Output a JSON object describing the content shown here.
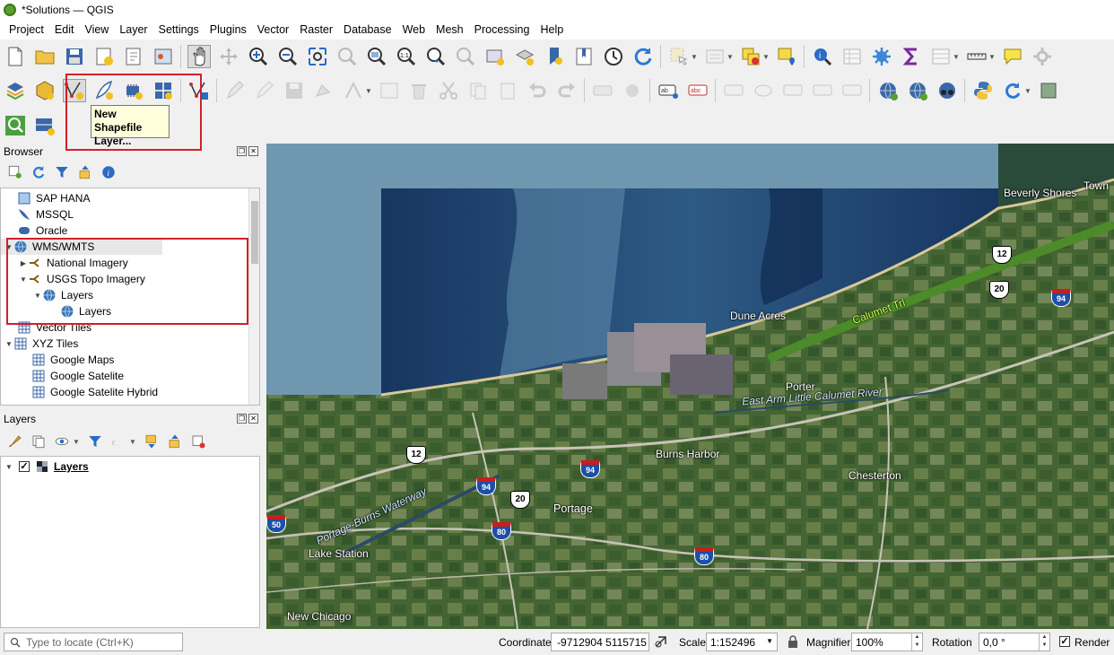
{
  "window": {
    "title": "*Solutions — QGIS"
  },
  "menu": [
    "Project",
    "Edit",
    "View",
    "Layer",
    "Settings",
    "Plugins",
    "Vector",
    "Raster",
    "Database",
    "Web",
    "Mesh",
    "Processing",
    "Help"
  ],
  "tooltip": {
    "line1": "New Shapefile",
    "line2": "Layer..."
  },
  "browser": {
    "title": "Browser",
    "items": [
      {
        "label": "SAP HANA",
        "icon": "sap-hana-icon"
      },
      {
        "label": "MSSQL",
        "icon": "mssql-icon"
      },
      {
        "label": "Oracle",
        "icon": "oracle-icon"
      },
      {
        "label": "WMS/WMTS",
        "icon": "globe-icon"
      },
      {
        "label": "National Imagery",
        "icon": "wms-connection-icon"
      },
      {
        "label": "USGS Topo Imagery",
        "icon": "wms-connection-icon"
      },
      {
        "label": "Layers",
        "icon": "globe-icon"
      },
      {
        "label": "Layers",
        "icon": "globe-icon"
      },
      {
        "label": "Vector Tiles",
        "icon": "grid-icon"
      },
      {
        "label": "XYZ Tiles",
        "icon": "grid-icon"
      },
      {
        "label": "Google Maps",
        "icon": "grid-icon"
      },
      {
        "label": "Google Satelite",
        "icon": "grid-icon"
      },
      {
        "label": "Google Satelite Hybrid",
        "icon": "grid-icon"
      }
    ]
  },
  "layers": {
    "title": "Layers",
    "items": [
      {
        "label": "Layers",
        "checked": true
      }
    ]
  },
  "map": {
    "labels": [
      "Beverly Shores",
      "Town",
      "Calumet Trl",
      "Dune Acres",
      "Porter",
      "East Arm Little Calumet River",
      "Burns Harbor",
      "Chesterton",
      "Portage-Burns Waterway",
      "Portage",
      "Lake Station",
      "New Chicago"
    ],
    "shields": {
      "us12_top": "12",
      "us20_top": "20",
      "i94_right": "94",
      "us12_left": "12",
      "i94_mid": "94",
      "i94_left": "94",
      "us20_mid": "20",
      "i80_mid": "80",
      "i80_low": "80",
      "i50_left": "50"
    }
  },
  "status": {
    "locator_placeholder": "Type to locate (Ctrl+K)",
    "coordinate_label": "Coordinate",
    "coordinate_value": "-9712904 5115715",
    "scale_label": "Scale",
    "scale_value": "1:152496",
    "magnifier_label": "Magnifier",
    "magnifier_value": "100%",
    "rotation_label": "Rotation",
    "rotation_value": "0,0 °",
    "render_label": "Render",
    "render_checked": true
  },
  "colors": {
    "highlight": "#d0202b",
    "water_deep": "#1c3b63",
    "water_light": "#6f97b0",
    "land": "#3f5f30"
  }
}
